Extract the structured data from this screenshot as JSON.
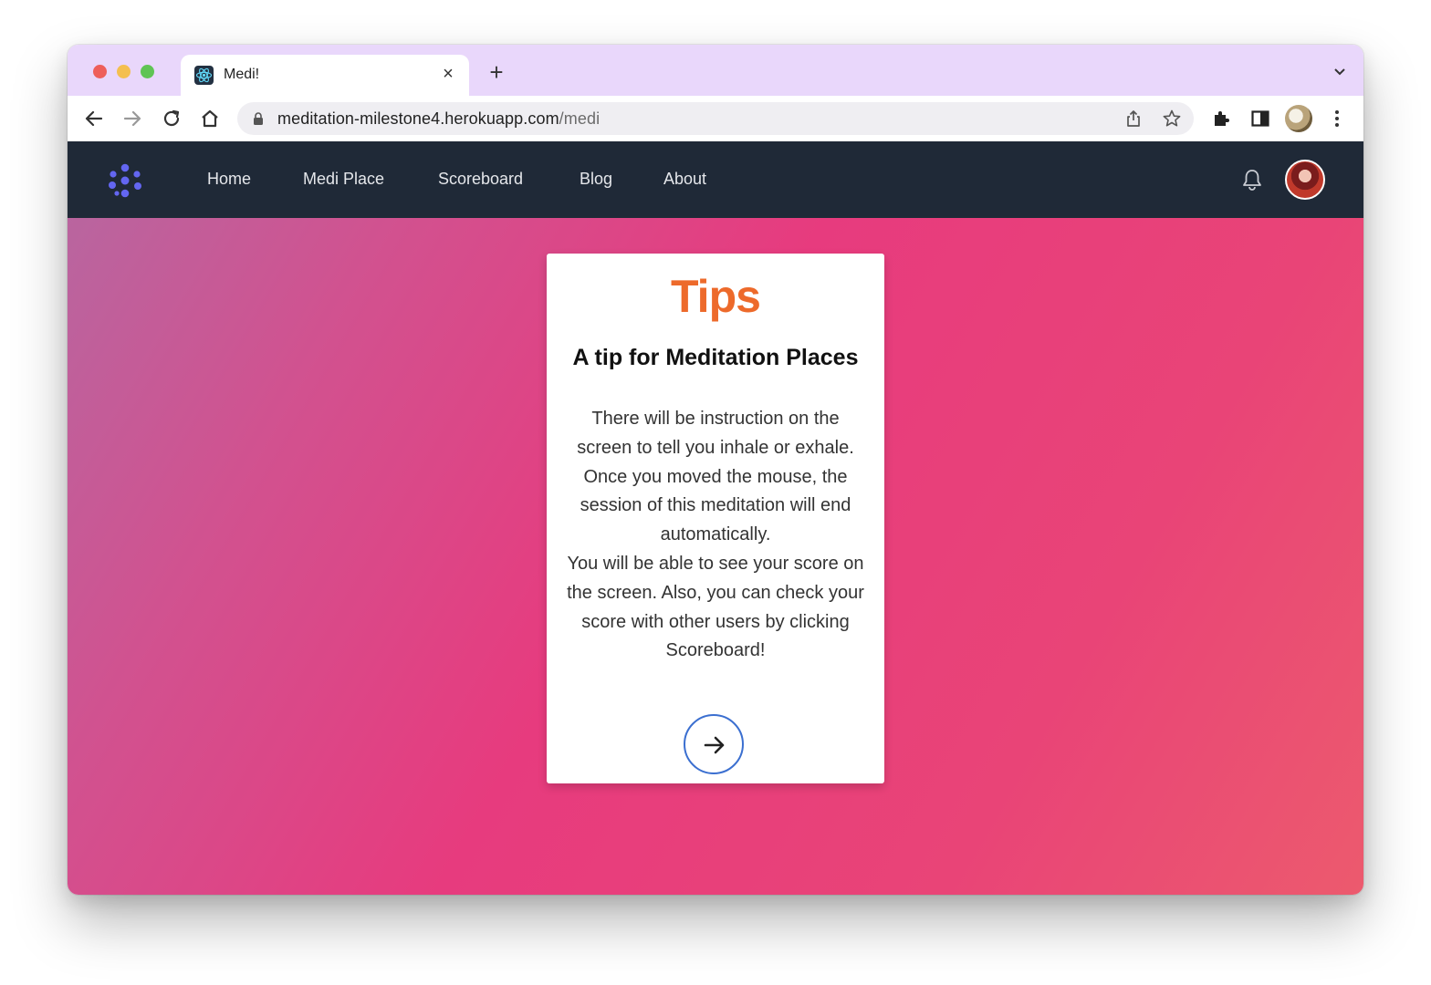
{
  "browser": {
    "tab_title": "Medi!",
    "tab_close_glyph": "×",
    "new_tab_glyph": "+",
    "url_host": "meditation-milestone4.herokuapp.com",
    "url_path": "/medi",
    "icons": [
      "back-icon",
      "forward-icon",
      "reload-icon",
      "home-icon",
      "lock-icon",
      "share-icon",
      "star-icon",
      "extensions-icon",
      "sidepanel-icon",
      "profile-icon",
      "more-icon",
      "tab-menu-icon"
    ]
  },
  "site_nav": {
    "links": [
      "Home",
      "Medi Place",
      "Scoreboard",
      "Blog",
      "About"
    ],
    "background": "#1f2937"
  },
  "card": {
    "title": "Tips",
    "subtitle": "A tip for Meditation Places",
    "paragraphs": [
      "There will be instruction on the screen to tell you inhale or exhale.",
      "Once you moved the mouse, the session of this meditation will end automatically.",
      "You will be able to see your score on the screen. Also, you can check your score with other users by clicking Scoreboard!"
    ],
    "title_color": "#ed6a2b",
    "button_icon": "arrow-right-icon"
  },
  "colors": {
    "tabstrip": "#e9d7fb",
    "gradient_start": "#b9659f",
    "gradient_mid": "#e73b7e",
    "gradient_end": "#ec5a6e"
  }
}
